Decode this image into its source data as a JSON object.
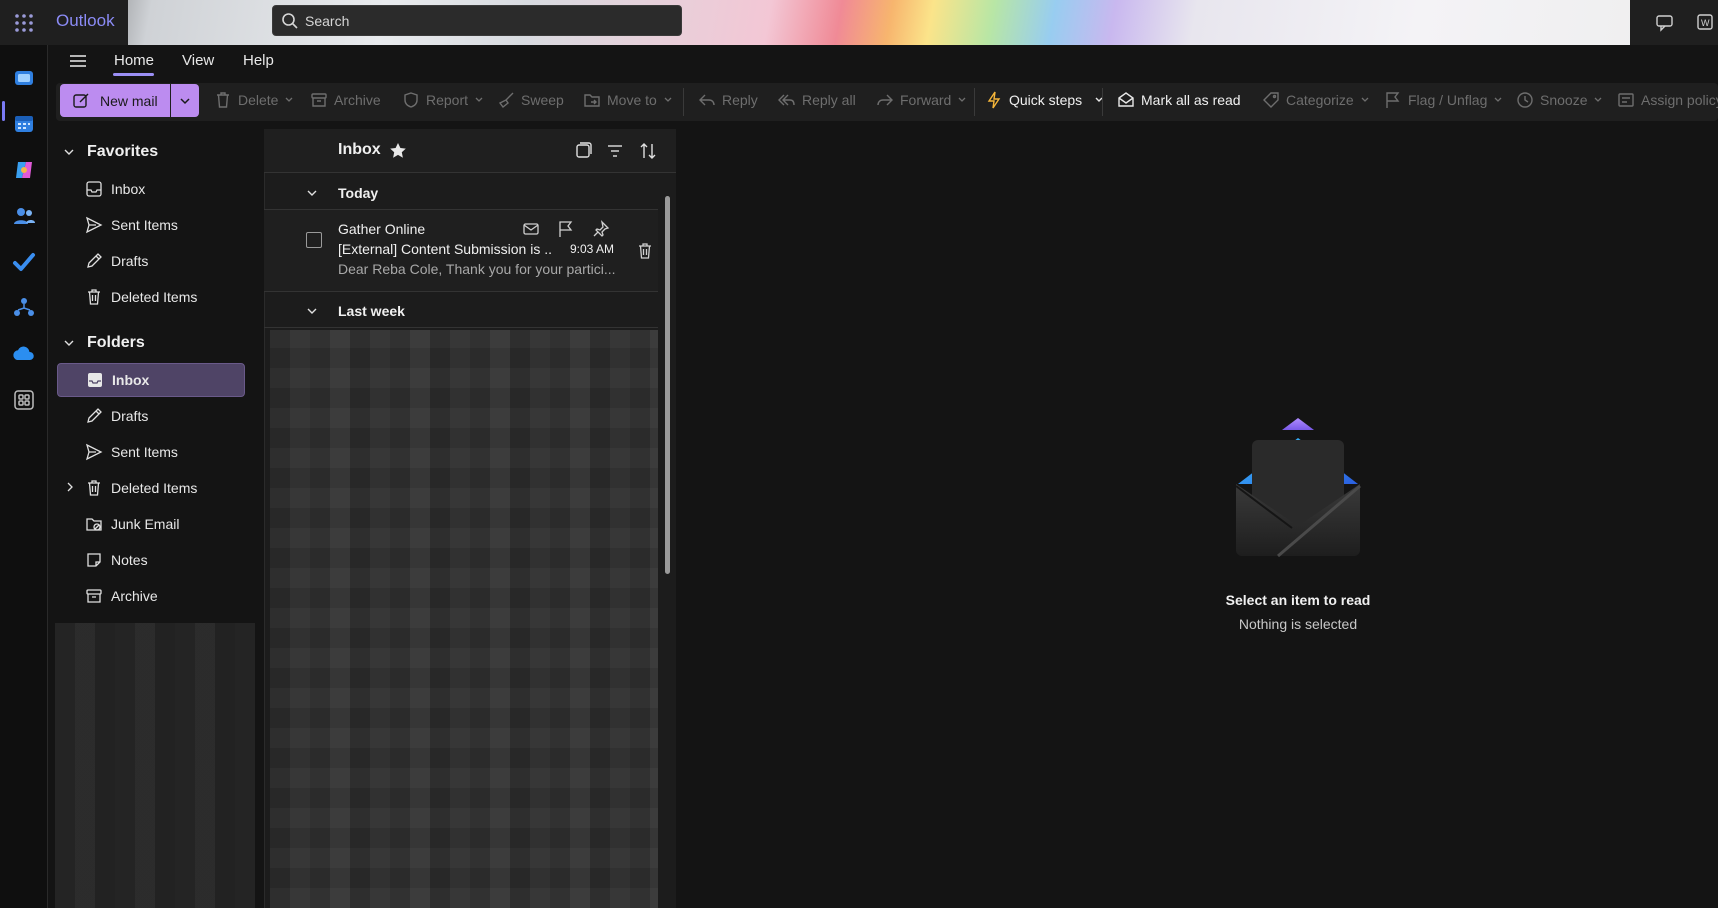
{
  "app": {
    "brand": "Outlook"
  },
  "search": {
    "placeholder": "Search"
  },
  "nav": {
    "tabs": [
      {
        "label": "Home"
      },
      {
        "label": "View"
      },
      {
        "label": "Help"
      }
    ]
  },
  "ribbon": {
    "new_mail": "New mail",
    "delete": "Delete",
    "archive": "Archive",
    "report": "Report",
    "sweep": "Sweep",
    "move_to": "Move to",
    "reply": "Reply",
    "reply_all": "Reply all",
    "forward": "Forward",
    "quick_steps": "Quick steps",
    "mark_all_read": "Mark all as read",
    "categorize": "Categorize",
    "flag_unflag": "Flag / Unflag",
    "snooze": "Snooze",
    "assign_policy": "Assign policy"
  },
  "favorites": {
    "title": "Favorites",
    "items": [
      {
        "label": "Inbox"
      },
      {
        "label": "Sent Items"
      },
      {
        "label": "Drafts"
      },
      {
        "label": "Deleted Items"
      }
    ]
  },
  "folders": {
    "title": "Folders",
    "items": [
      {
        "label": "Inbox"
      },
      {
        "label": "Drafts"
      },
      {
        "label": "Sent Items"
      },
      {
        "label": "Deleted Items"
      },
      {
        "label": "Junk Email"
      },
      {
        "label": "Notes"
      },
      {
        "label": "Archive"
      }
    ]
  },
  "message_list": {
    "title": "Inbox",
    "groups": [
      {
        "label": "Today"
      },
      {
        "label": "Last week"
      }
    ],
    "messages": [
      {
        "from": "Gather Online",
        "subject": "[External] Content Submission is ...",
        "time": "9:03 AM",
        "preview": "Dear Reba Cole, Thank you for your partici..."
      }
    ]
  },
  "reading_pane": {
    "title": "Select an item to read",
    "subtitle": "Nothing is selected"
  },
  "colors": {
    "accent": "#bc8cf0",
    "brand": "#8b8bf5",
    "selected_folder": "#4f4466"
  }
}
